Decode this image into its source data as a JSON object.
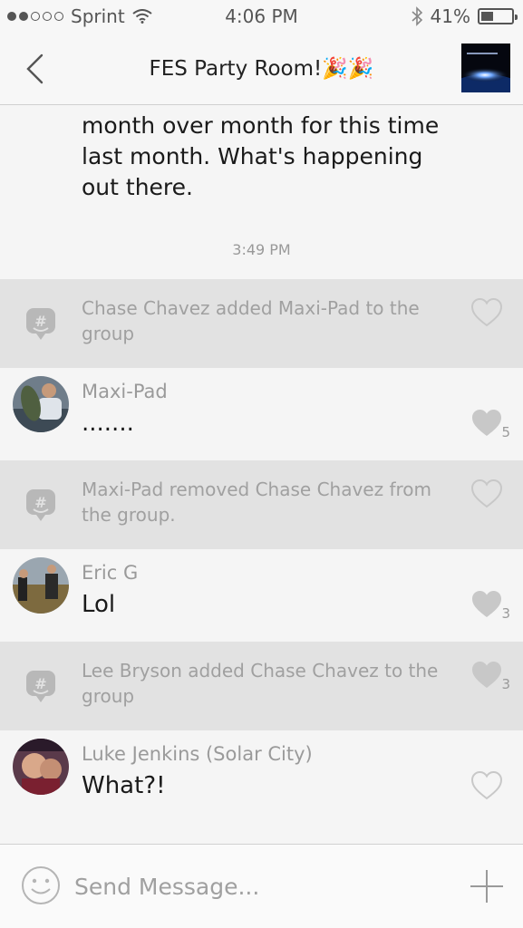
{
  "status_bar": {
    "carrier": "Sprint",
    "time": "4:06 PM",
    "battery_percent": "41%",
    "battery_level": 0.41,
    "signal_bars_filled": 2,
    "signal_bars_total": 5,
    "icons": [
      "signal-dots-icon",
      "wifi-icon",
      "bluetooth-icon",
      "battery-icon"
    ]
  },
  "header": {
    "title": "FES Party Room!🎉🎉",
    "back_icon": "chevron-left-icon",
    "group_avatar_icon": "group-avatar"
  },
  "feed": {
    "previous_message_text": "month over month for this time last month. What's happening out there.",
    "timestamp": "3:49 PM",
    "items": [
      {
        "type": "system",
        "text": "Chase Chavez added Maxi-Pad to the group",
        "likes": "",
        "liked": false
      },
      {
        "type": "user",
        "name": "Maxi-Pad",
        "text": ".......",
        "likes": "5",
        "liked": true
      },
      {
        "type": "system",
        "text": "Maxi-Pad removed Chase Chavez from the group.",
        "likes": "",
        "liked": false
      },
      {
        "type": "user",
        "name": "Eric G",
        "text": "Lol",
        "likes": "3",
        "liked": true
      },
      {
        "type": "system",
        "text": "Lee Bryson added Chase Chavez to the group",
        "likes": "3",
        "liked": true
      },
      {
        "type": "user",
        "name": "Luke Jenkins (Solar City)",
        "text": "What?!",
        "likes": "",
        "liked": false
      }
    ]
  },
  "composer": {
    "placeholder": "Send Message...",
    "emoji_icon": "smiley-icon",
    "add_icon": "plus-icon"
  },
  "colors": {
    "system_row_bg": "#e2e2e2",
    "user_row_bg": "#f5f5f5",
    "muted_text": "#a0a0a0",
    "heart_filled": "#c8c8c8"
  }
}
